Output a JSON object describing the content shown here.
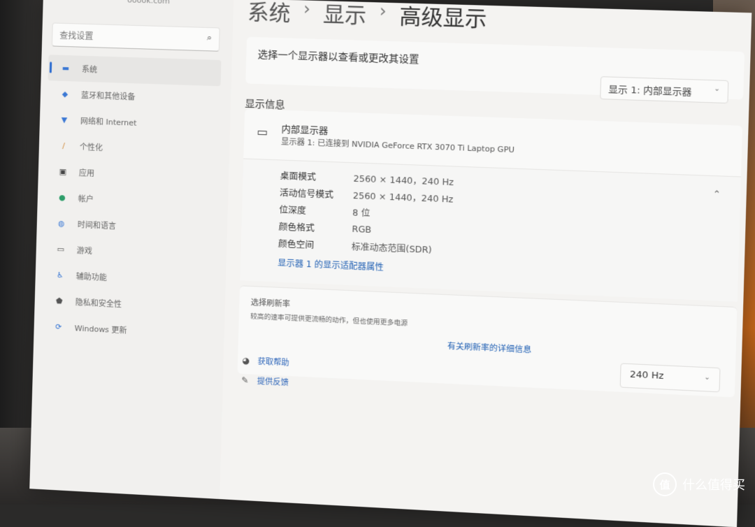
{
  "account": {
    "email": "ooook.com"
  },
  "search": {
    "placeholder": "查找设置"
  },
  "sidebar": {
    "items": [
      {
        "icon": "monitor-icon",
        "label": "系统",
        "active": true
      },
      {
        "icon": "bluetooth-icon",
        "label": "蓝牙和其他设备"
      },
      {
        "icon": "wifi-icon",
        "label": "网络和 Internet"
      },
      {
        "icon": "brush-icon",
        "label": "个性化"
      },
      {
        "icon": "apps-icon",
        "label": "应用"
      },
      {
        "icon": "person-icon",
        "label": "帐户"
      },
      {
        "icon": "globe-icon",
        "label": "时间和语言"
      },
      {
        "icon": "gamepad-icon",
        "label": "游戏"
      },
      {
        "icon": "accessibility-icon",
        "label": "辅助功能"
      },
      {
        "icon": "shield-icon",
        "label": "隐私和安全性"
      },
      {
        "icon": "update-icon",
        "label": "Windows 更新"
      }
    ]
  },
  "breadcrumb": {
    "items": [
      "系统",
      "显示",
      "高级显示"
    ]
  },
  "display_select": {
    "label": "选择一个显示器以查看或更改其设置",
    "value": "显示 1: 内部显示器"
  },
  "display_info": {
    "section_title": "显示信息",
    "title": "内部显示器",
    "subtitle": "显示器 1: 已连接到 NVIDIA GeForce RTX 3070 Ti Laptop GPU",
    "rows": [
      {
        "label": "桌面模式",
        "value": "2560 × 1440，240 Hz"
      },
      {
        "label": "活动信号模式",
        "value": "2560 × 1440，240 Hz"
      },
      {
        "label": "位深度",
        "value": "8 位"
      },
      {
        "label": "颜色格式",
        "value": "RGB"
      },
      {
        "label": "颜色空间",
        "value": "标准动态范围(SDR)"
      }
    ],
    "adapter_link": "显示器 1 的显示适配器属性"
  },
  "refresh": {
    "title": "选择刷新率",
    "description": "较高的速率可提供更流畅的动作，但也使用更多电源",
    "link": "有关刷新率的详细信息",
    "value": "240 Hz"
  },
  "help": {
    "items": [
      {
        "icon": "help-icon",
        "label": "获取帮助"
      },
      {
        "icon": "feedback-icon",
        "label": "提供反馈"
      }
    ]
  },
  "watermark": {
    "logo": "值",
    "text": "什么值得买"
  }
}
